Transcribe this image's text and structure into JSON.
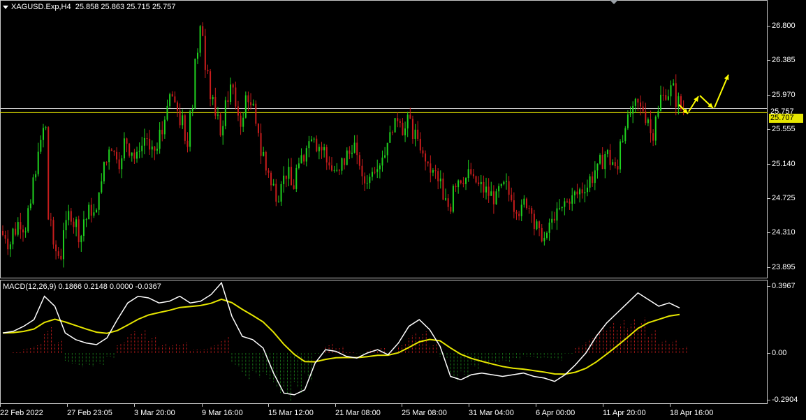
{
  "chart": {
    "symbol_line": "XAGUSD.Exp,H4",
    "ohlc": "25.858 25.863 25.715 25.757",
    "macd_line": "MACD(12,26,9) 0.1866 0.2148 0.0000 -0.0367"
  },
  "price_axis": {
    "ticks": [
      "26.800",
      "26.385",
      "25.970",
      "25.555",
      "25.140",
      "24.725",
      "24.310",
      "23.895"
    ],
    "current_price": "25.757",
    "level_price": "25.707"
  },
  "macd_axis": {
    "ticks": [
      "0.3967",
      "0.00",
      "-0.2904"
    ]
  },
  "time_axis": {
    "labels": [
      "22 Feb 2022",
      "27 Feb 23:05",
      "3 Mar 20:00",
      "9 Mar 16:00",
      "15 Mar 12:00",
      "21 Mar 08:00",
      "25 Mar 08:00",
      "31 Mar 04:00",
      "6 Apr 00:00",
      "11 Apr 20:00",
      "18 Apr 16:00"
    ]
  },
  "colors": {
    "bull": "#1fd11f",
    "bear": "#c81c1c",
    "level": "#e6e600",
    "macd_main": "#ffffff",
    "macd_signal": "#e6e600",
    "hist_up": "#c81c1c",
    "hist_down": "#1a7f1a",
    "arrow": "#ffff00"
  },
  "chart_data": {
    "type": "candlestick",
    "ylim": [
      23.7,
      27.05
    ],
    "closes": [
      24.2,
      24.1,
      24.25,
      24.35,
      24.3,
      24.5,
      24.9,
      25.3,
      25.5,
      24.4,
      24.0,
      23.95,
      24.3,
      24.45,
      24.35,
      24.2,
      24.4,
      24.5,
      24.45,
      24.8,
      25.1,
      25.3,
      25.2,
      25.1,
      25.35,
      25.25,
      25.15,
      25.3,
      25.4,
      25.2,
      25.25,
      25.45,
      25.7,
      25.9,
      25.75,
      25.6,
      25.3,
      25.8,
      26.4,
      26.7,
      26.3,
      25.9,
      25.6,
      25.5,
      25.9,
      26.0,
      25.7,
      25.6,
      25.9,
      25.75,
      25.5,
      25.2,
      25.0,
      24.8,
      24.7,
      24.9,
      24.95,
      24.8,
      25.0,
      25.15,
      25.35,
      25.45,
      25.3,
      25.25,
      25.1,
      25.0,
      24.95,
      25.1,
      25.2,
      25.3,
      25.1,
      24.85,
      24.9,
      25.05,
      25.1,
      25.2,
      25.4,
      25.55,
      25.65,
      25.5,
      25.6,
      25.45,
      25.3,
      25.15,
      25.0,
      24.95,
      24.85,
      24.6,
      24.55,
      24.85,
      24.9,
      24.9,
      24.95,
      24.85,
      24.8,
      24.75,
      24.7,
      24.65,
      24.75,
      24.8,
      24.7,
      24.55,
      24.5,
      24.6,
      24.55,
      24.3,
      24.2,
      24.15,
      24.35,
      24.45,
      24.5,
      24.6,
      24.65,
      24.7,
      24.75,
      24.8,
      24.9,
      25.0,
      25.1,
      25.2,
      25.1,
      25.0,
      25.4,
      25.6,
      25.7,
      25.8,
      25.75,
      25.65,
      25.45,
      25.7,
      25.9,
      25.95,
      26.0,
      25.85,
      25.76
    ],
    "macd": [
      0.12,
      0.13,
      0.16,
      0.2,
      0.34,
      0.28,
      0.12,
      0.08,
      0.06,
      0.05,
      0.09,
      0.2,
      0.3,
      0.34,
      0.33,
      0.3,
      0.31,
      0.34,
      0.3,
      0.31,
      0.35,
      0.42,
      0.22,
      0.1,
      0.08,
      0.03,
      -0.12,
      -0.24,
      -0.25,
      -0.22,
      -0.06,
      0.02,
      0.01,
      -0.02,
      -0.03,
      0.0,
      0.02,
      -0.01,
      0.06,
      0.16,
      0.2,
      0.14,
      0.04,
      -0.14,
      -0.16,
      -0.13,
      -0.12,
      -0.13,
      -0.14,
      -0.13,
      -0.12,
      -0.14,
      -0.15,
      -0.17,
      -0.13,
      -0.07,
      0.0,
      0.1,
      0.18,
      0.24,
      0.3,
      0.36,
      0.32,
      0.28,
      0.3,
      0.27
    ]
  },
  "annotations": {
    "forecast_arrows": 4
  }
}
